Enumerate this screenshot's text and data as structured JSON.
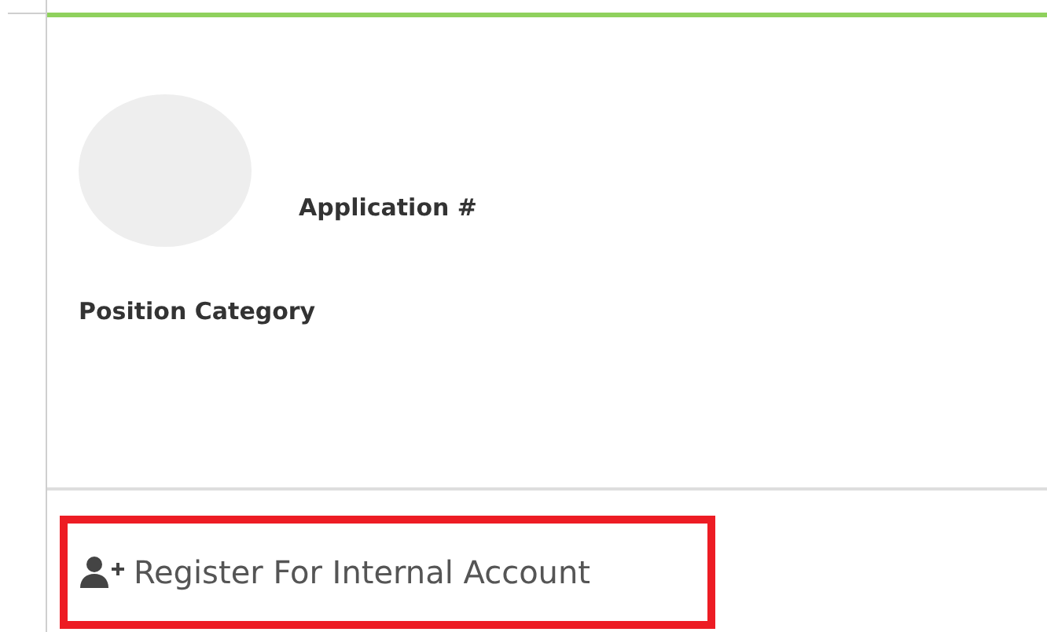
{
  "profile": {
    "application_label": "Application #",
    "position_label": "Position Category"
  },
  "register_button": {
    "label": "Register For Internal Account",
    "highlighted": true
  }
}
